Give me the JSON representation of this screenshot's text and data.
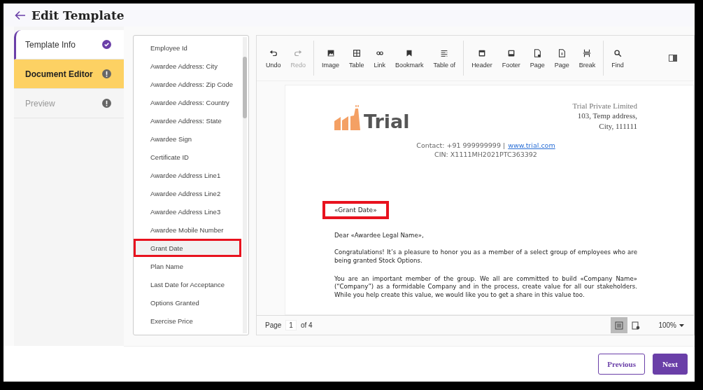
{
  "header": {
    "title": "Edit Template"
  },
  "steps": [
    {
      "label": "Template Info",
      "selected": false,
      "kind": "done",
      "disabled": false
    },
    {
      "label": "Document Editor",
      "selected": true,
      "kind": "warning",
      "disabled": false
    },
    {
      "label": "Preview",
      "selected": false,
      "kind": "warning",
      "disabled": true
    }
  ],
  "fields": [
    {
      "label": "Employee Id",
      "selected": false,
      "highlighted": false
    },
    {
      "label": "Awardee Address: City",
      "selected": false,
      "highlighted": false
    },
    {
      "label": "Awardee Address: Zip Code",
      "selected": false,
      "highlighted": false
    },
    {
      "label": "Awardee Address: Country",
      "selected": false,
      "highlighted": false
    },
    {
      "label": "Awardee Address: State",
      "selected": false,
      "highlighted": false
    },
    {
      "label": "Awardee Sign",
      "selected": false,
      "highlighted": false
    },
    {
      "label": "Certificate ID",
      "selected": false,
      "highlighted": false
    },
    {
      "label": "Awardee Address Line1",
      "selected": false,
      "highlighted": false
    },
    {
      "label": "Awardee Address Line2",
      "selected": false,
      "highlighted": false
    },
    {
      "label": "Awardee Address Line3",
      "selected": false,
      "highlighted": false
    },
    {
      "label": "Awardee Mobile Number",
      "selected": false,
      "highlighted": false
    },
    {
      "label": "Grant Date",
      "selected": true,
      "highlighted": true
    },
    {
      "label": "Plan Name",
      "selected": false,
      "highlighted": false
    },
    {
      "label": "Last Date for Acceptance",
      "selected": false,
      "highlighted": false
    },
    {
      "label": "Options Granted",
      "selected": false,
      "highlighted": false
    },
    {
      "label": "Exercise Price",
      "selected": false,
      "highlighted": false
    }
  ],
  "toolbar": {
    "groups": [
      [
        {
          "kind": "undo",
          "label": "Undo",
          "disabled": false
        },
        {
          "kind": "redo",
          "label": "Redo",
          "disabled": true
        }
      ],
      [
        {
          "kind": "image",
          "label": "Image",
          "disabled": false
        },
        {
          "kind": "table",
          "label": "Table",
          "disabled": false
        },
        {
          "kind": "link",
          "label": "Link",
          "disabled": false
        },
        {
          "kind": "bookmark",
          "label": "Bookmark",
          "disabled": false
        },
        {
          "kind": "toc",
          "label": "Table of",
          "disabled": false
        }
      ],
      [
        {
          "kind": "header",
          "label": "Header",
          "disabled": false
        },
        {
          "kind": "footer",
          "label": "Footer",
          "disabled": false
        },
        {
          "kind": "page-setup",
          "label": "Page",
          "disabled": false
        },
        {
          "kind": "page-number",
          "label": "Page",
          "disabled": false
        },
        {
          "kind": "break",
          "label": "Break",
          "disabled": false
        }
      ],
      [
        {
          "kind": "find",
          "label": "Find",
          "disabled": false
        }
      ]
    ]
  },
  "document": {
    "logo_text": "Trial",
    "address": [
      "Trial Private Limited",
      "103, Temp address,",
      "City, 111111"
    ],
    "contact": "Contact: +91 999999999 |",
    "website": "www.trial.com",
    "cin": "CIN: X1111MH2021PTC363392",
    "merge_field": {
      "text": "«Grant Date»",
      "highlighted": true
    },
    "salutation": "Dear «Awardee Legal Name»,",
    "paragraphs": [
      "Congratulations!  It’s a pleasure to honor you as a member of a select group of employees who are being granted Stock Options.",
      "You are an important member of the group. We all are committed to build «Company Name» (“Company”) as a formidable Company and in the process, create value for all our stakeholders. While you help create this value, we would like you to get a share in this value too."
    ]
  },
  "status_bar": {
    "page_label": "Page",
    "page": "1",
    "of": "of 4",
    "views": [
      {
        "kind": "print",
        "selected": true
      },
      {
        "kind": "web",
        "selected": false
      }
    ],
    "zoom": "100%"
  },
  "buttons": [
    {
      "kind": "secondary",
      "label": "Previous"
    },
    {
      "kind": "primary",
      "label": "Next"
    }
  ]
}
